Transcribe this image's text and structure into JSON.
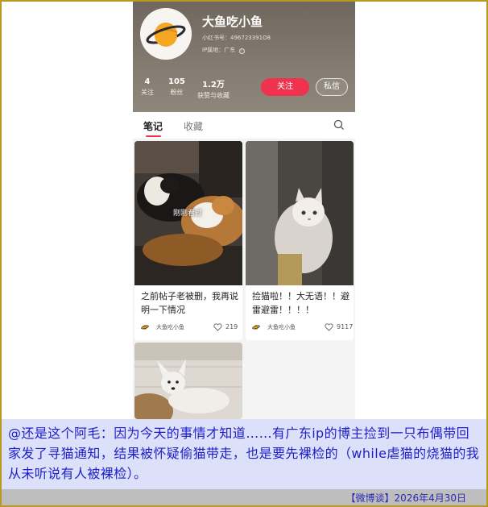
{
  "profile": {
    "username": "大鱼吃小鱼",
    "id_text": "小红书号：496723391O8",
    "ip_text": "IP属地：广东",
    "stats": [
      {
        "num": "4",
        "label": "关注"
      },
      {
        "num": "105",
        "label": "粉丝"
      },
      {
        "num": "1.2万",
        "label": "获赞与收藏"
      }
    ],
    "follow_label": "关注",
    "message_label": "私信"
  },
  "tabs": [
    "笔记",
    "收藏"
  ],
  "posts": [
    {
      "title": "之前帖子老被删，我再说明一下情况",
      "author": "大鱼吃小鱼",
      "likes": "219",
      "tag": "刚刚看过"
    },
    {
      "title": "捡猫啦！！大无语！！避雷避雷！！！！",
      "author": "大鱼吃小鱼",
      "likes": "9117"
    }
  ],
  "caption": "@还是这个阿毛：因为今天的事情才知道……有广东ip的博主捡到一只布偶带回家发了寻猫通知，结果被怀疑偷猫带走，也是要先裸检的（while虐猫的烧猫的我从未听说有人被裸检）。",
  "footer": "【微博谈】2026年4月30日",
  "colors": {
    "accent": "#f0324f",
    "caption_text": "#1d1fc8",
    "caption_bg": "#dde0f9"
  }
}
